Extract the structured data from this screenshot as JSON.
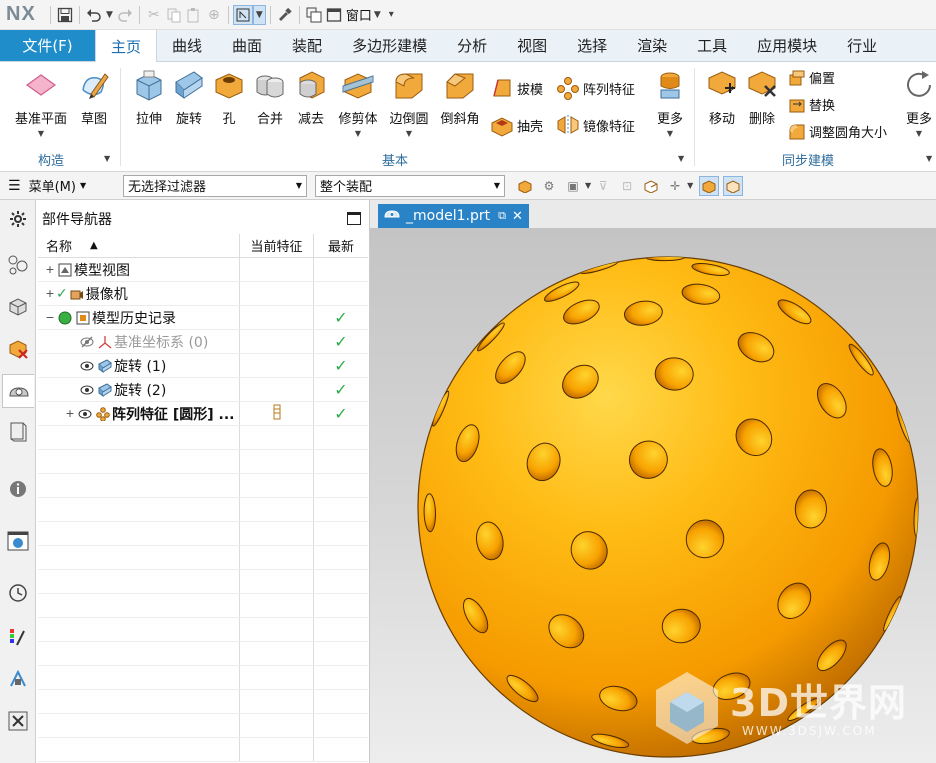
{
  "app": {
    "logo": "NX",
    "window_menu_label": "窗口"
  },
  "tabs": [
    "文件(F)",
    "主页",
    "曲线",
    "曲面",
    "装配",
    "多边形建模",
    "分析",
    "视图",
    "选择",
    "渲染",
    "工具",
    "应用模块",
    "行业"
  ],
  "ribbon": {
    "construct": {
      "label": "构造",
      "datum_plane": "基准平面",
      "sketch": "草图"
    },
    "basic": {
      "label": "基本",
      "extrude": "拉伸",
      "revolve": "旋转",
      "hole": "孔",
      "unite": "合并",
      "subtract": "减去",
      "trim_body": "修剪体",
      "edge_blend": "边倒圆",
      "chamfer": "倒斜角",
      "draft": "拔模",
      "shell": "抽壳",
      "pattern_feature": "阵列特征",
      "mirror_feature": "镜像特征",
      "more": "更多"
    },
    "sync": {
      "label": "同步建模",
      "move": "移动",
      "delete": "删除",
      "offset": "偏置",
      "replace": "替换",
      "resize_blend": "调整圆角大小",
      "more": "更多"
    }
  },
  "filterbar": {
    "menu": "菜单(M)",
    "selection_filter": "无选择过滤器",
    "scope": "整个装配"
  },
  "navigator": {
    "title": "部件导航器",
    "columns": {
      "name": "名称",
      "current": "当前特征",
      "latest": "最新"
    },
    "rows": [
      {
        "name": "模型视图"
      },
      {
        "name": "摄像机"
      },
      {
        "name": "模型历史记录"
      },
      {
        "name": "基准坐标系 (0)"
      },
      {
        "name": "旋转 (1)"
      },
      {
        "name": "旋转 (2)"
      },
      {
        "name": "阵列特征 [圆形] ..."
      }
    ]
  },
  "viewport": {
    "tab_label": "_model1.prt",
    "part_color": "#f5a000"
  },
  "watermark": {
    "brand": "3D世界网",
    "url": "WWW.3DSJW.COM"
  },
  "colors": {
    "accent": "#1e8dc9",
    "active_tab_text": "#1b6fb3",
    "group_label": "#2e6d9c",
    "check": "#2fa84f"
  }
}
